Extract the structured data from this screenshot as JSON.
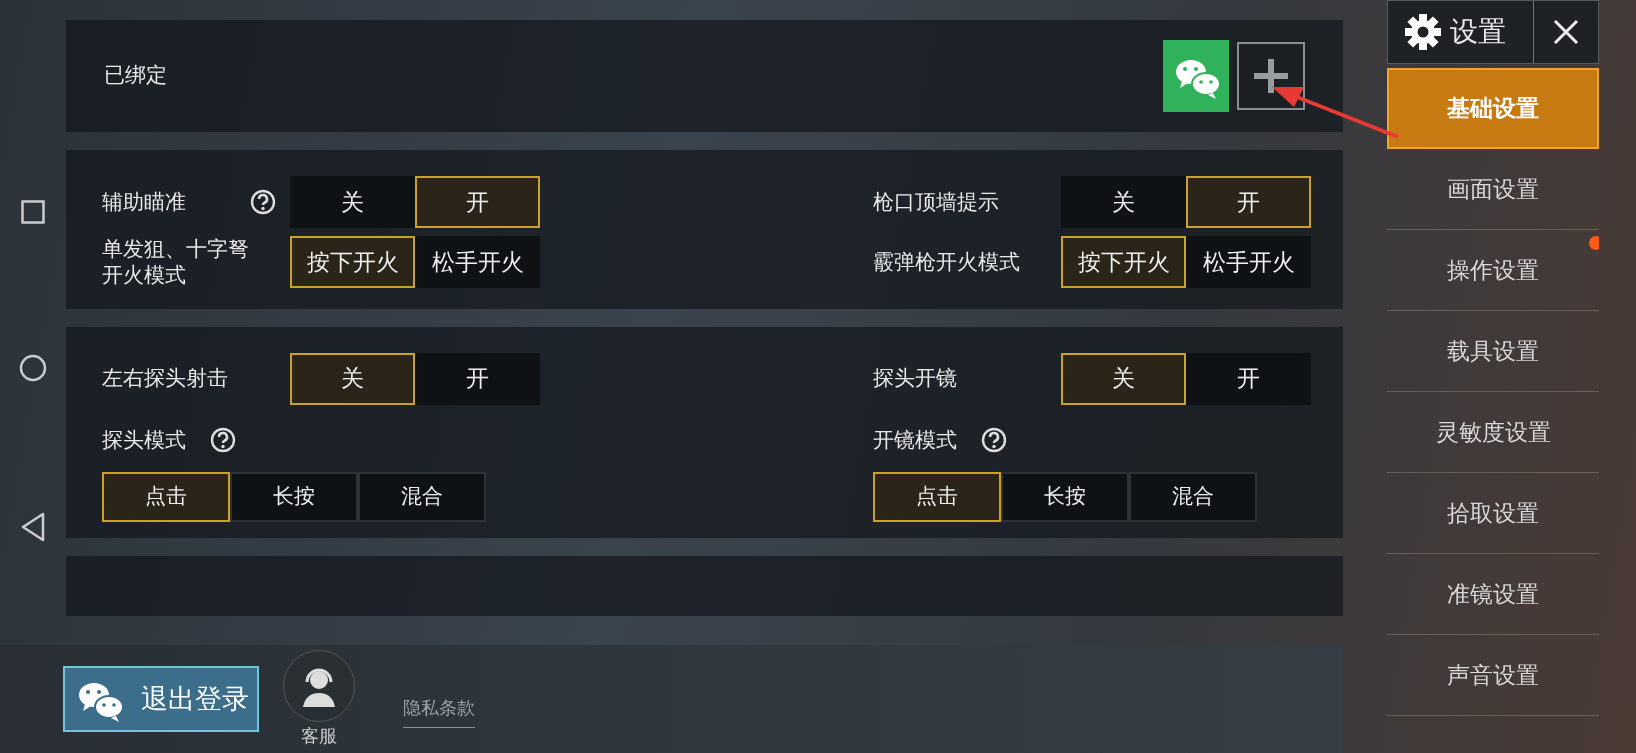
{
  "account": {
    "label": "已绑定",
    "linked": [
      {
        "kind": "wechat"
      },
      {
        "kind": "add"
      }
    ]
  },
  "sections": [
    {
      "items": [
        {
          "label": "辅助瞄准",
          "help": true,
          "kind": "toggle",
          "options": [
            {
              "label": "关",
              "selected": false
            },
            {
              "label": "开",
              "selected": true
            }
          ]
        },
        {
          "label": "枪口顶墙提示",
          "help": false,
          "kind": "toggle",
          "options": [
            {
              "label": "关",
              "selected": false
            },
            {
              "label": "开",
              "selected": true
            }
          ]
        },
        {
          "label": "单发狙、十字弩开火模式",
          "help": false,
          "kind": "toggle",
          "options": [
            {
              "label": "按下开火",
              "selected": true
            },
            {
              "label": "松手开火",
              "selected": false
            }
          ]
        },
        {
          "label": "霰弹枪开火模式",
          "help": false,
          "kind": "toggle",
          "options": [
            {
              "label": "按下开火",
              "selected": true
            },
            {
              "label": "松手开火",
              "selected": false
            }
          ]
        }
      ]
    },
    {
      "items": [
        {
          "label": "左右探头射击",
          "help": false,
          "kind": "toggle",
          "options": [
            {
              "label": "关",
              "selected": true
            },
            {
              "label": "开",
              "selected": false
            }
          ]
        },
        {
          "label": "探头开镜",
          "help": false,
          "kind": "toggle",
          "options": [
            {
              "label": "关",
              "selected": true
            },
            {
              "label": "开",
              "selected": false
            }
          ]
        },
        {
          "label": "探头模式",
          "help": true,
          "kind": "mode",
          "options": [
            {
              "label": "点击",
              "selected": true
            },
            {
              "label": "长按",
              "selected": false
            },
            {
              "label": "混合",
              "selected": false
            }
          ]
        },
        {
          "label": "开镜模式",
          "help": true,
          "kind": "mode",
          "options": [
            {
              "label": "点击",
              "selected": true
            },
            {
              "label": "长按",
              "selected": false
            },
            {
              "label": "混合",
              "selected": false
            }
          ]
        }
      ]
    }
  ],
  "footer": {
    "logout": "退出登录",
    "support": "客服",
    "privacy": "隐私条款"
  },
  "sidebar": {
    "title": "设置",
    "items": [
      {
        "label": "基础设置",
        "selected": true,
        "badge": false
      },
      {
        "label": "画面设置",
        "selected": false,
        "badge": false
      },
      {
        "label": "操作设置",
        "selected": false,
        "badge": true
      },
      {
        "label": "载具设置",
        "selected": false,
        "badge": false
      },
      {
        "label": "灵敏度设置",
        "selected": false,
        "badge": false
      },
      {
        "label": "拾取设置",
        "selected": false,
        "badge": false
      },
      {
        "label": "准镜设置",
        "selected": false,
        "badge": false
      },
      {
        "label": "声音设置",
        "selected": false,
        "badge": false
      }
    ]
  }
}
